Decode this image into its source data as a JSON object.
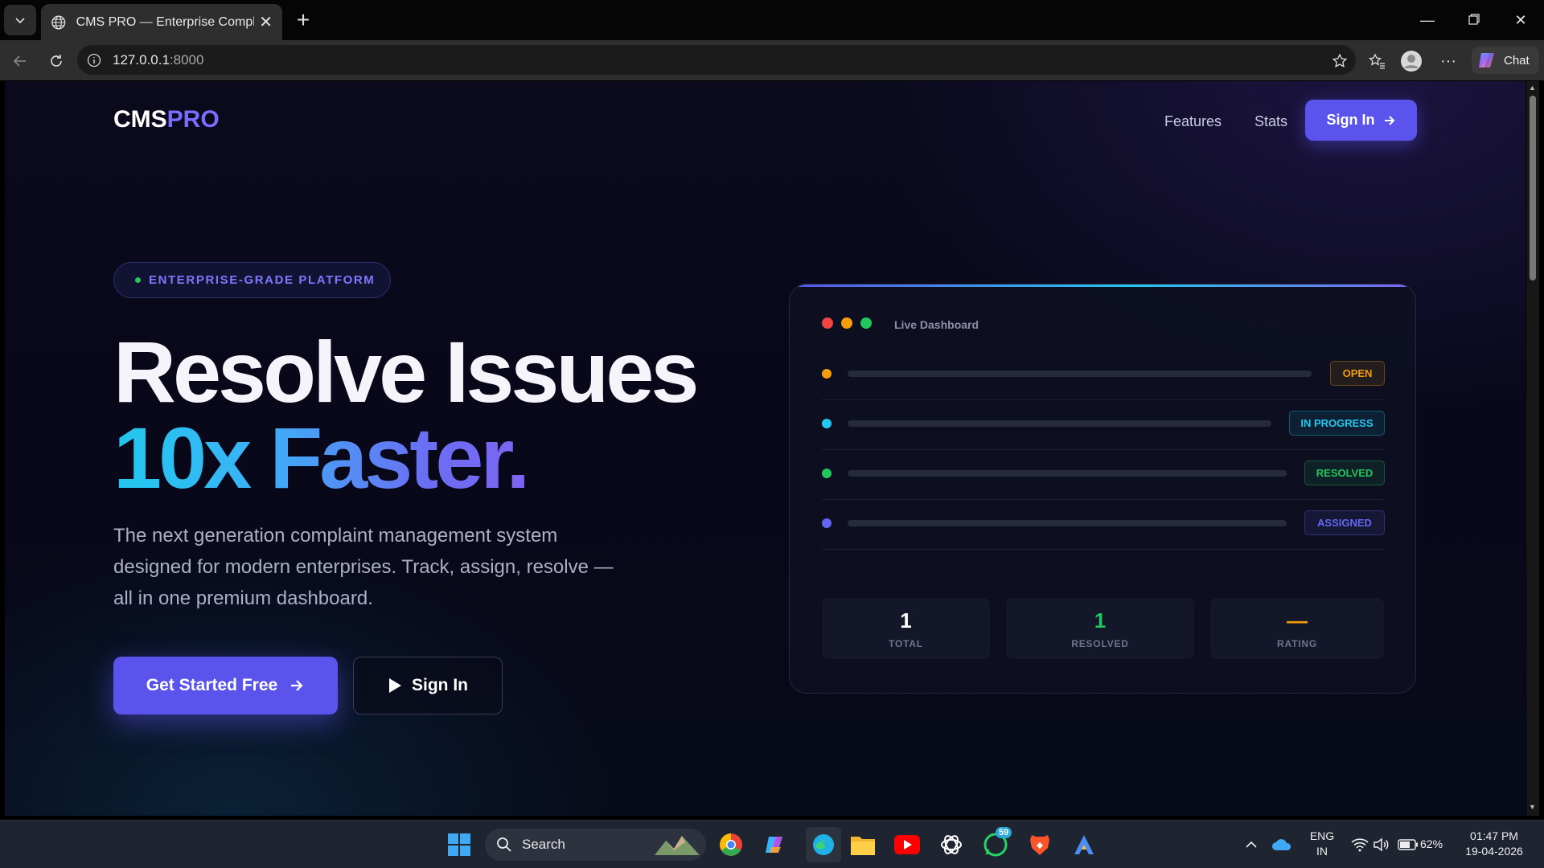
{
  "browser": {
    "tab_title": "CMS PRO — Enterprise Complaint",
    "url_host": "127.0.0.1",
    "url_port": ":8000",
    "chat_label": "Chat"
  },
  "nav": {
    "logo_main": "CMS",
    "logo_accent": "PRO",
    "features": "Features",
    "stats": "Stats",
    "signin": "Sign In"
  },
  "hero": {
    "badge": "ENTERPRISE-GRADE PLATFORM",
    "line1": "Resolve Issues",
    "line2": "10x Faster.",
    "description": "The next generation complaint management system designed for modern enterprises. Track, assign, resolve — all in one premium dashboard.",
    "cta_primary": "Get Started Free",
    "cta_secondary": "Sign In"
  },
  "dashboard": {
    "title": "Live Dashboard",
    "rows": [
      {
        "status": "OPEN",
        "color": "#f59e0b"
      },
      {
        "status": "IN PROGRESS",
        "color": "#22c8ee"
      },
      {
        "status": "RESOLVED",
        "color": "#22c55e"
      },
      {
        "status": "ASSIGNED",
        "color": "#6366f1"
      }
    ],
    "stats": [
      {
        "value": "1",
        "label": "TOTAL",
        "color": "#ffffff"
      },
      {
        "value": "1",
        "label": "RESOLVED",
        "color": "#22c55e"
      },
      {
        "value": "—",
        "label": "RATING",
        "color": "#f59e0b"
      }
    ]
  },
  "taskbar": {
    "search_label": "Search",
    "whatsapp_badge": "59",
    "lang_line1": "ENG",
    "lang_line2": "IN",
    "battery": "62%",
    "time": "01:47 PM",
    "date": "19-04-2026"
  }
}
